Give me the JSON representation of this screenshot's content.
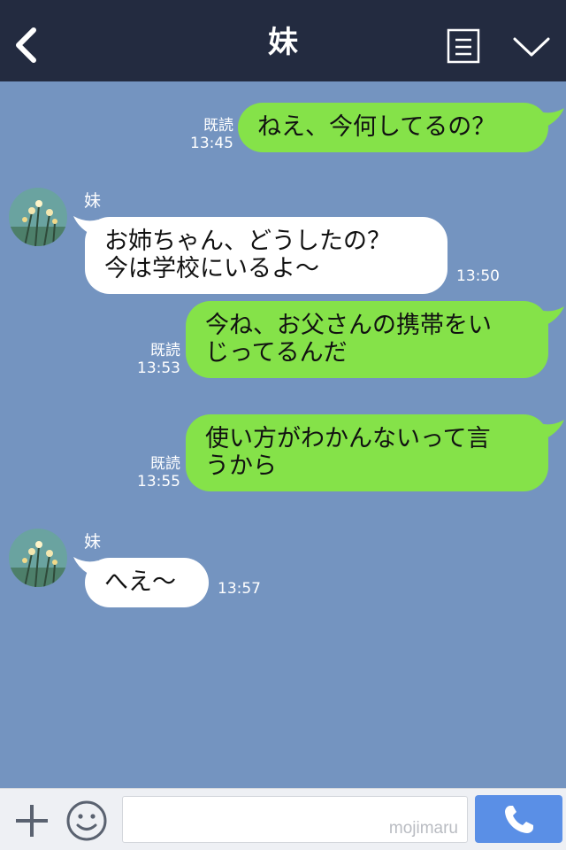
{
  "header": {
    "title": "妹",
    "back_icon": "chevron-left-icon",
    "notes_icon": "notes-icon",
    "menu_icon": "chevron-down-icon"
  },
  "messages": [
    {
      "direction": "out",
      "lines": [
        "ねえ、今何してるの？"
      ],
      "read_label": "既読",
      "time": "13:45"
    },
    {
      "direction": "in",
      "sender": "妹",
      "lines": [
        "お姉ちゃん、どうしたの？",
        "今は学校にいるよ〜"
      ],
      "time": "13:50"
    },
    {
      "direction": "out",
      "lines": [
        "今ね、お父さんの携帯をい",
        "じってるんだ"
      ],
      "read_label": "既読",
      "time": "13:53"
    },
    {
      "direction": "out",
      "lines": [
        "使い方がわかんないって言",
        "うから"
      ],
      "read_label": "既読",
      "time": "13:55"
    },
    {
      "direction": "in",
      "sender": "妹",
      "lines": [
        "へえ〜"
      ],
      "time": "13:57"
    }
  ],
  "composer": {
    "watermark": "mojimaru",
    "plus_icon": "plus-icon",
    "emoji_icon": "smiley-icon",
    "call_icon": "phone-icon"
  },
  "colors": {
    "header_bg": "#232b40",
    "chat_bg": "#7494c0",
    "outgoing_bubble": "#85e249",
    "incoming_bubble": "#ffffff",
    "call_button": "#5a8fe6"
  }
}
